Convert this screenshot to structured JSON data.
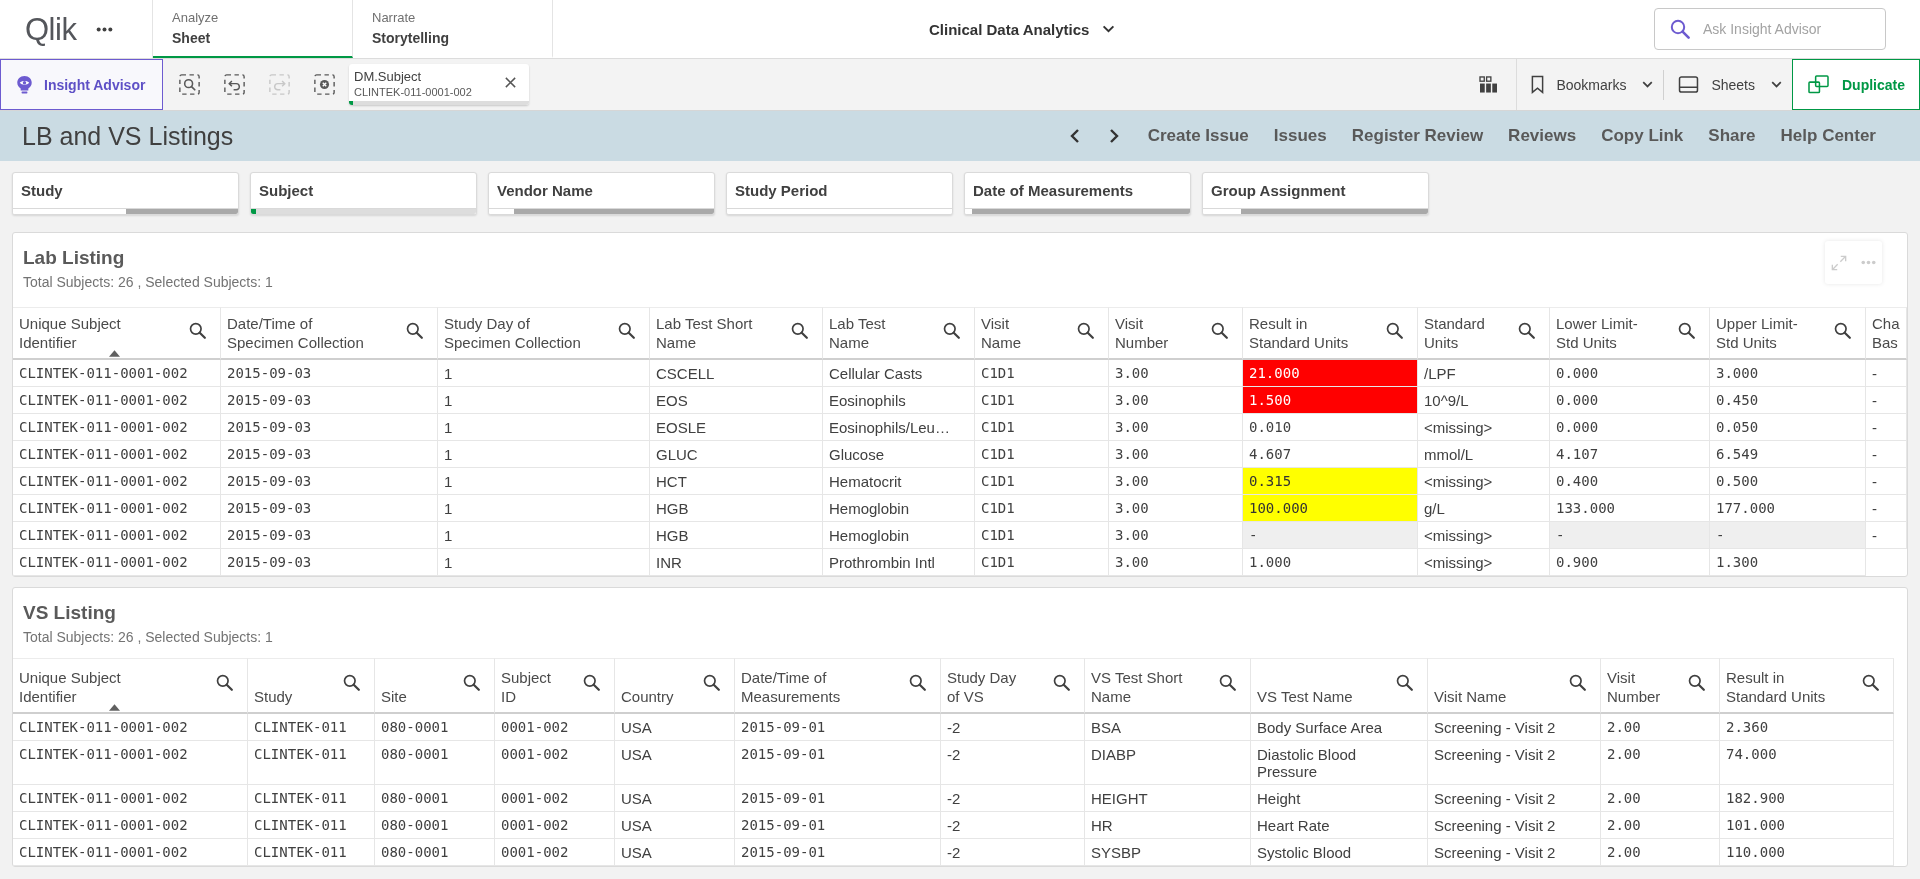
{
  "top_bar": {
    "logo": "Qlik",
    "tabs": [
      {
        "section": "Analyze",
        "label": "Sheet",
        "selected": true
      },
      {
        "section": "Narrate",
        "label": "Storytelling",
        "selected": false
      }
    ],
    "app_title": "Clinical Data Analytics",
    "search": {
      "placeholder": "Ask Insight Advisor"
    }
  },
  "toolbar": {
    "insight_advisor": "Insight Advisor",
    "selection_tools": [
      {
        "kind": "search",
        "disabled": false
      },
      {
        "kind": "back",
        "disabled": false
      },
      {
        "kind": "forward",
        "disabled": true
      },
      {
        "kind": "clear",
        "disabled": false
      }
    ],
    "selections": [
      {
        "field": "DM.Subject",
        "value": "CLINTEK-011-0001-002",
        "level": 0.02
      }
    ],
    "bookmarks": "Bookmarks",
    "sheets": "Sheets",
    "duplicate": "Duplicate"
  },
  "sheet_header": {
    "title": "LB and VS Listings",
    "actions": [
      "Create Issue",
      "Issues",
      "Register Review",
      "Reviews",
      "Copy Link",
      "Share",
      "Help Center"
    ]
  },
  "filters": [
    {
      "label": "Study",
      "bar": [
        {
          "kind": "possible",
          "level": 0.5
        },
        {
          "kind": "excluded",
          "level": 0.5
        }
      ]
    },
    {
      "label": "Subject",
      "bar": [
        {
          "kind": "selected",
          "level": 0.02
        },
        {
          "kind": "alternative",
          "level": 0.98
        }
      ]
    },
    {
      "label": "Vendor Name",
      "bar": [
        {
          "kind": "possible",
          "level": 0.11
        },
        {
          "kind": "excluded",
          "level": 0.89
        }
      ]
    },
    {
      "label": "Study Period",
      "bar": [
        {
          "kind": "possible",
          "level": 1
        }
      ]
    },
    {
      "label": "Date of Measurements",
      "bar": [
        {
          "kind": "possible",
          "level": 0.03
        },
        {
          "kind": "excluded",
          "level": 0.97
        }
      ]
    },
    {
      "label": "Group Assignment",
      "bar": [
        {
          "kind": "possible",
          "level": 0.17
        },
        {
          "kind": "excluded",
          "level": 0.83
        }
      ]
    }
  ],
  "lab_listing": {
    "title": "Lab Listing",
    "subtitle": "Total Subjects: 26 , Selected Subjects: 1",
    "hover_actions": true,
    "columns": [
      {
        "label": "Unique Subject\nIdentifier",
        "kind": "mono",
        "sorted": true,
        "search": true
      },
      {
        "label": "Date/Time of\nSpecimen Collection",
        "kind": "mono",
        "sorted": false,
        "search": true
      },
      {
        "label": "Study Day of\nSpecimen Collection",
        "kind": "text",
        "sorted": false,
        "search": true
      },
      {
        "label": "Lab Test Short\nName",
        "kind": "text",
        "sorted": false,
        "search": true
      },
      {
        "label": "Lab Test\nName",
        "kind": "text",
        "sorted": false,
        "search": true
      },
      {
        "label": "Visit\nName",
        "kind": "mono",
        "sorted": false,
        "search": true
      },
      {
        "label": "Visit\nNumber",
        "kind": "mono",
        "sorted": false,
        "search": true
      },
      {
        "label": "Result in\nStandard Units",
        "kind": "mono",
        "sorted": false,
        "search": true
      },
      {
        "label": "Standard\nUnits",
        "kind": "text",
        "sorted": false,
        "search": true
      },
      {
        "label": "Lower Limit-\nStd Units",
        "kind": "mono",
        "sorted": false,
        "search": true
      },
      {
        "label": "Upper Limit-\nStd Units",
        "kind": "mono",
        "sorted": false,
        "search": true
      },
      {
        "label": "Cha\nBas",
        "kind": "text",
        "sorted": false,
        "search": false
      }
    ],
    "rows": [
      {
        "cells": [
          "CLINTEK-011-0001-002",
          "2015-09-03",
          "1",
          "CSCELL",
          "Cellular Casts",
          "C1D1",
          "3.00",
          {
            "text": "21.000",
            "color": "#ff0000"
          },
          "/LPF",
          "0.000",
          "3.000",
          "-"
        ]
      },
      {
        "cells": [
          "CLINTEK-011-0001-002",
          "2015-09-03",
          "1",
          "EOS",
          "Eosinophils",
          "C1D1",
          "3.00",
          {
            "text": "1.500",
            "color": "#ff0000"
          },
          "10^9/L",
          "0.000",
          "0.450",
          "-"
        ]
      },
      {
        "cells": [
          "CLINTEK-011-0001-002",
          "2015-09-03",
          "1",
          "EOSLE",
          "Eosinophils/Leu…",
          "C1D1",
          "3.00",
          "0.010",
          "<missing>",
          "0.000",
          "0.050",
          "-"
        ]
      },
      {
        "cells": [
          "CLINTEK-011-0001-002",
          "2015-09-03",
          "1",
          "GLUC",
          "Glucose",
          "C1D1",
          "3.00",
          "4.607",
          "mmol/L",
          "4.107",
          "6.549",
          "-"
        ]
      },
      {
        "cells": [
          "CLINTEK-011-0001-002",
          "2015-09-03",
          "1",
          "HCT",
          "Hematocrit",
          "C1D1",
          "3.00",
          {
            "text": "0.315",
            "color": "#ffff00"
          },
          "<missing>",
          "0.400",
          "0.500",
          "-"
        ]
      },
      {
        "cells": [
          "CLINTEK-011-0001-002",
          "2015-09-03",
          "1",
          "HGB",
          "Hemoglobin",
          "C1D1",
          "3.00",
          {
            "text": "100.000",
            "color": "#ffff00"
          },
          "g/L",
          "133.000",
          "177.000",
          "-"
        ]
      },
      {
        "cells": [
          "CLINTEK-011-0001-002",
          "2015-09-03",
          "1",
          "HGB",
          "Hemoglobin",
          "C1D1",
          "3.00",
          {
            "text": "-",
            "is_null": true
          },
          "<missing>",
          {
            "text": "-",
            "is_null": true
          },
          {
            "text": "-",
            "is_null": true
          },
          "-"
        ]
      },
      {
        "cells": [
          "CLINTEK-011-0001-002",
          "2015-09-03",
          "1",
          "INR",
          "Prothrombin Intl",
          "C1D1",
          "3.00",
          "1.000",
          "<missing>",
          "0.900",
          "1.300"
        ]
      }
    ]
  },
  "vs_listing": {
    "title": "VS Listing",
    "subtitle": "Total Subjects: 26 , Selected Subjects: 1",
    "columns": [
      {
        "label": "Unique Subject\nIdentifier",
        "kind": "mono",
        "sorted": true,
        "search": true
      },
      {
        "label": "Study",
        "kind": "mono",
        "sorted": false,
        "search": true
      },
      {
        "label": "Site",
        "kind": "mono",
        "sorted": false,
        "search": true
      },
      {
        "label": "Subject\nID",
        "kind": "mono",
        "sorted": false,
        "search": true
      },
      {
        "label": "Country",
        "kind": "text",
        "sorted": false,
        "search": true
      },
      {
        "label": "Date/Time of\nMeasurements",
        "kind": "mono",
        "sorted": false,
        "search": true
      },
      {
        "label": "Study Day\nof VS",
        "kind": "text",
        "sorted": false,
        "search": true
      },
      {
        "label": "VS Test Short\nName",
        "kind": "text",
        "sorted": false,
        "search": true
      },
      {
        "label": "VS Test Name",
        "kind": "text",
        "sorted": false,
        "search": true
      },
      {
        "label": "Visit Name",
        "kind": "text",
        "sorted": false,
        "search": true
      },
      {
        "label": "Visit\nNumber",
        "kind": "mono",
        "sorted": false,
        "search": true
      },
      {
        "label": "Result in\nStandard Units",
        "kind": "mono",
        "sorted": false,
        "search": true
      }
    ],
    "rows": [
      {
        "cells": [
          "CLINTEK-011-0001-002",
          "CLINTEK-011",
          "080-0001",
          "0001-002",
          "USA",
          "2015-09-01",
          "-2",
          "BSA",
          "Body Surface Area",
          "Screening - Visit 2",
          "2.00",
          "2.360"
        ]
      },
      {
        "cells": [
          "CLINTEK-011-0001-002",
          "CLINTEK-011",
          "080-0001",
          "0001-002",
          "USA",
          "2015-09-01",
          "-2",
          "DIABP",
          "Diastolic Blood Pressure",
          "Screening - Visit 2",
          "2.00",
          "74.000"
        ]
      },
      {
        "cells": [
          "CLINTEK-011-0001-002",
          "CLINTEK-011",
          "080-0001",
          "0001-002",
          "USA",
          "2015-09-01",
          "-2",
          "HEIGHT",
          "Height",
          "Screening - Visit 2",
          "2.00",
          "182.900"
        ]
      },
      {
        "cells": [
          "CLINTEK-011-0001-002",
          "CLINTEK-011",
          "080-0001",
          "0001-002",
          "USA",
          "2015-09-01",
          "-2",
          "HR",
          "Heart Rate",
          "Screening - Visit 2",
          "2.00",
          "101.000"
        ]
      },
      {
        "cells": [
          "CLINTEK-011-0001-002",
          "CLINTEK-011",
          "080-0001",
          "0001-002",
          "USA",
          "2015-09-01",
          "-2",
          "SYSBP",
          "Systolic Blood",
          "Screening - Visit 2",
          "2.00",
          "110.000"
        ]
      }
    ]
  }
}
